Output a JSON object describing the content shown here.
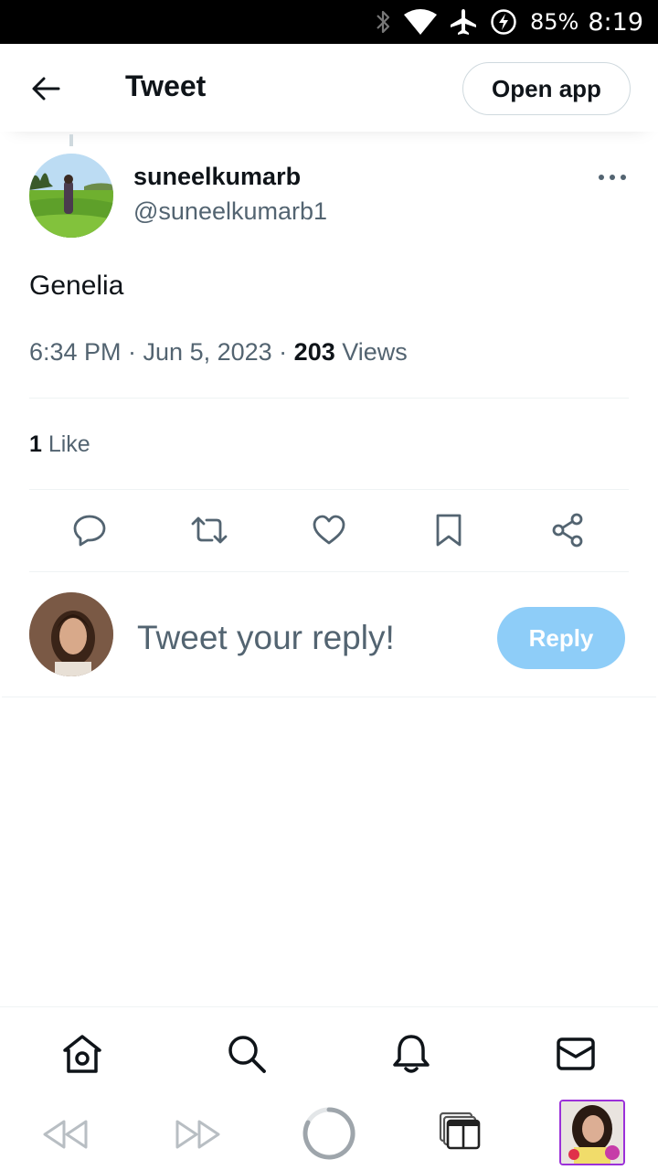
{
  "status_bar": {
    "icons": [
      "bluetooth-icon",
      "wifi-icon",
      "airplane-mode-icon",
      "battery-charging-icon"
    ],
    "battery": "85%",
    "time": "8:19"
  },
  "header": {
    "title": "Tweet",
    "open_app_label": "Open app"
  },
  "tweet": {
    "author_name": "suneelkumarb",
    "author_handle": "@suneelkumarb1",
    "text": "Genelia",
    "timestamp": "6:34 PM · Jun 5, 2023",
    "separator": " · ",
    "views_count": "203",
    "views_label": " Views",
    "likes_count": "1",
    "likes_label": " Like",
    "actions": [
      "reply-icon",
      "retweet-icon",
      "like-icon",
      "bookmark-icon",
      "share-icon"
    ]
  },
  "reply_box": {
    "placeholder": "Tweet your reply!",
    "button_label": "Reply"
  },
  "bottom_nav": [
    "home-icon",
    "search-icon",
    "notifications-icon",
    "messages-icon"
  ],
  "browser_bar": [
    "rewind-icon",
    "fast-forward-icon",
    "loading-spinner-icon",
    "tabs-icon",
    "tab-thumbnail"
  ],
  "colors": {
    "primary_text": "#0f1419",
    "secondary_text": "#536471",
    "border": "#cfd9de",
    "reply_button_disabled": "#8ecdf8"
  }
}
